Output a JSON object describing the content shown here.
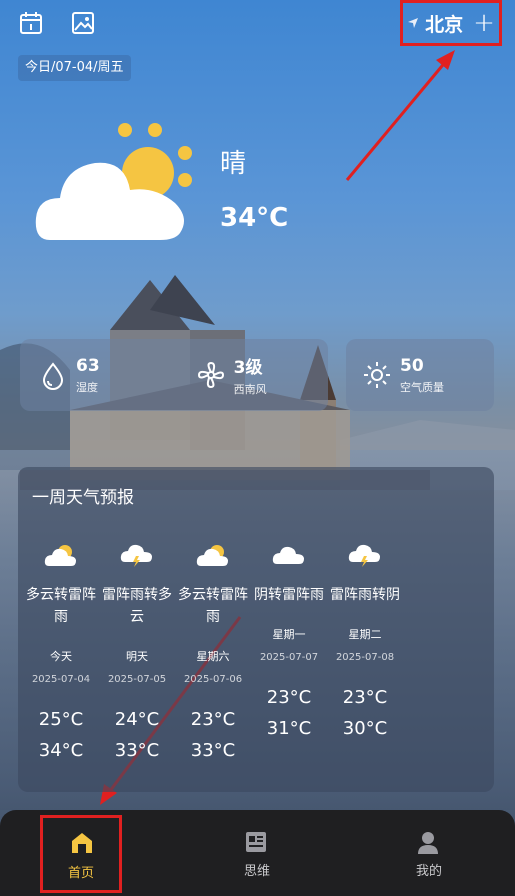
{
  "header": {
    "date_label": "今日/07-04/周五",
    "city": "北京",
    "add_symbol": "+",
    "icons": [
      "calendar-icon",
      "image-icon",
      "location-arrow-icon"
    ]
  },
  "current": {
    "condition": "晴",
    "temperature": "34°C",
    "icon": "partly-cloudy-icon"
  },
  "stats": [
    {
      "value": "63",
      "label": "湿度",
      "icon": "humidity-drop-icon"
    },
    {
      "value": "3级",
      "label": "西南风",
      "icon": "fan-icon"
    },
    {
      "value": "50",
      "label": "空气质量",
      "icon": "sun-outline-icon"
    }
  ],
  "forecast": {
    "title": "一周天气预报",
    "days": [
      {
        "weather": "多云转雷阵雨",
        "name": "今天",
        "date": "2025-07-04",
        "low": "25°C",
        "high": "34°C",
        "icon": "partly-cloudy-icon"
      },
      {
        "weather": "雷阵雨转多云",
        "name": "明天",
        "date": "2025-07-05",
        "low": "24°C",
        "high": "33°C",
        "icon": "thunder-cloud-icon"
      },
      {
        "weather": "多云转雷阵雨",
        "name": "星期六",
        "date": "2025-07-06",
        "low": "23°C",
        "high": "33°C",
        "icon": "partly-cloudy-icon"
      },
      {
        "weather": "阴转雷阵雨",
        "name": "星期一",
        "date": "2025-07-07",
        "low": "23°C",
        "high": "31°C",
        "icon": "cloud-icon"
      },
      {
        "weather": "雷阵雨转阴",
        "name": "星期二",
        "date": "2025-07-08",
        "low": "23°C",
        "high": "30°C",
        "icon": "thunder-cloud-icon"
      }
    ]
  },
  "nav": [
    {
      "label": "首页",
      "icon": "home-icon",
      "active": true
    },
    {
      "label": "思维",
      "icon": "mind-icon",
      "active": false
    },
    {
      "label": "我的",
      "icon": "user-icon",
      "active": false
    }
  ],
  "colors": {
    "accent": "#f5c542",
    "annotation": "#e02020",
    "nav_bg": "#1f1f21"
  }
}
